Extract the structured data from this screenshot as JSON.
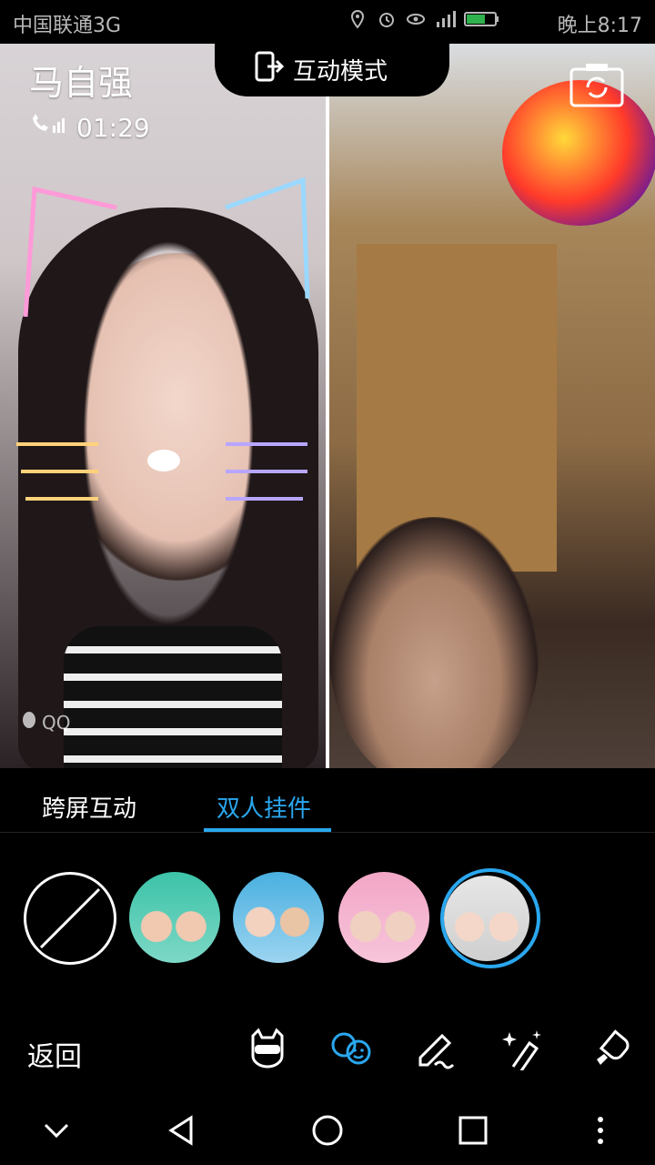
{
  "status_bar": {
    "carrier": "中国联通3G",
    "time": "晚上8:17"
  },
  "call": {
    "caller_name": "马自强",
    "duration": "01:29",
    "mode_label": "互动模式",
    "watermark": "QQ"
  },
  "tabs": [
    {
      "label": "跨屏互动",
      "active": false
    },
    {
      "label": "双人挂件",
      "active": true
    }
  ],
  "pendants": [
    {
      "name": "none"
    },
    {
      "name": "bear-ears"
    },
    {
      "name": "gentleman-mustache"
    },
    {
      "name": "black-cat"
    },
    {
      "name": "cat-whiskers",
      "selected": true
    }
  ],
  "toolbar": {
    "back_label": "返回",
    "tools": [
      "face-mask",
      "double-pendant",
      "doodle-pen",
      "magic-wand",
      "popsicle"
    ]
  },
  "colors": {
    "accent": "#2aa7ee",
    "background": "#000000"
  }
}
